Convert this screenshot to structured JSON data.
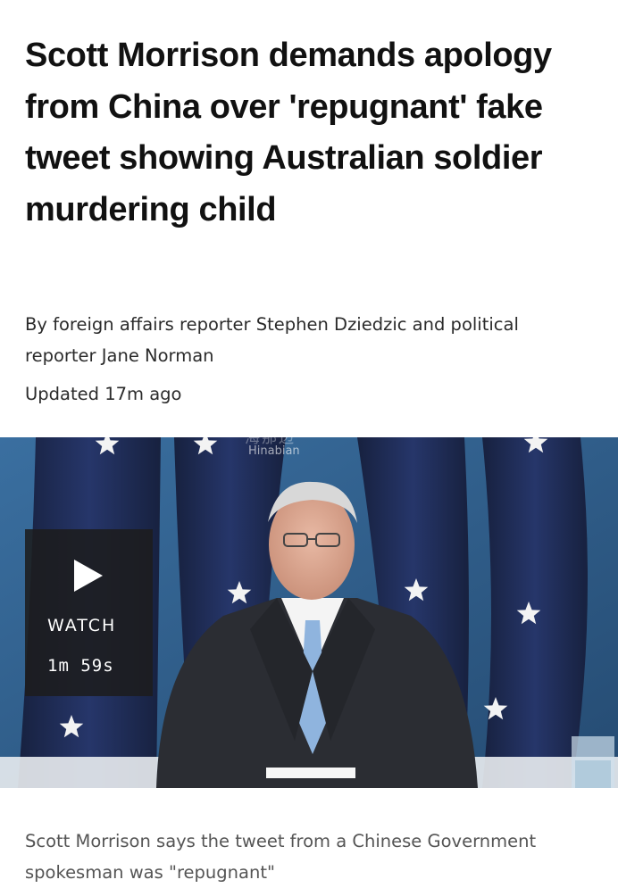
{
  "article": {
    "headline": "Scott Morrison demands apology from China over 'repugnant' fake tweet showing Australian soldier murdering child",
    "byline": "By foreign affairs reporter Stephen Dziedzic and political reporter Jane Norman",
    "updated": "Updated 17m ago"
  },
  "media": {
    "watermark_main": "海那边",
    "watermark_sub": "Hinabian",
    "watch_label": "WATCH",
    "duration": "1m 59s",
    "caption": "Scott Morrison says the tweet from a Chinese Government spokesman was \"repugnant\""
  },
  "colors": {
    "background": "#ffffff",
    "headline_text": "#111111",
    "body_text": "#2b2b2b",
    "caption_text": "#555555",
    "video_backdrop": "#2f5d8a",
    "flag_navy": "#1f2c55",
    "watch_overlay": "#1c1c1e"
  },
  "icons": {
    "play": "play-icon"
  }
}
